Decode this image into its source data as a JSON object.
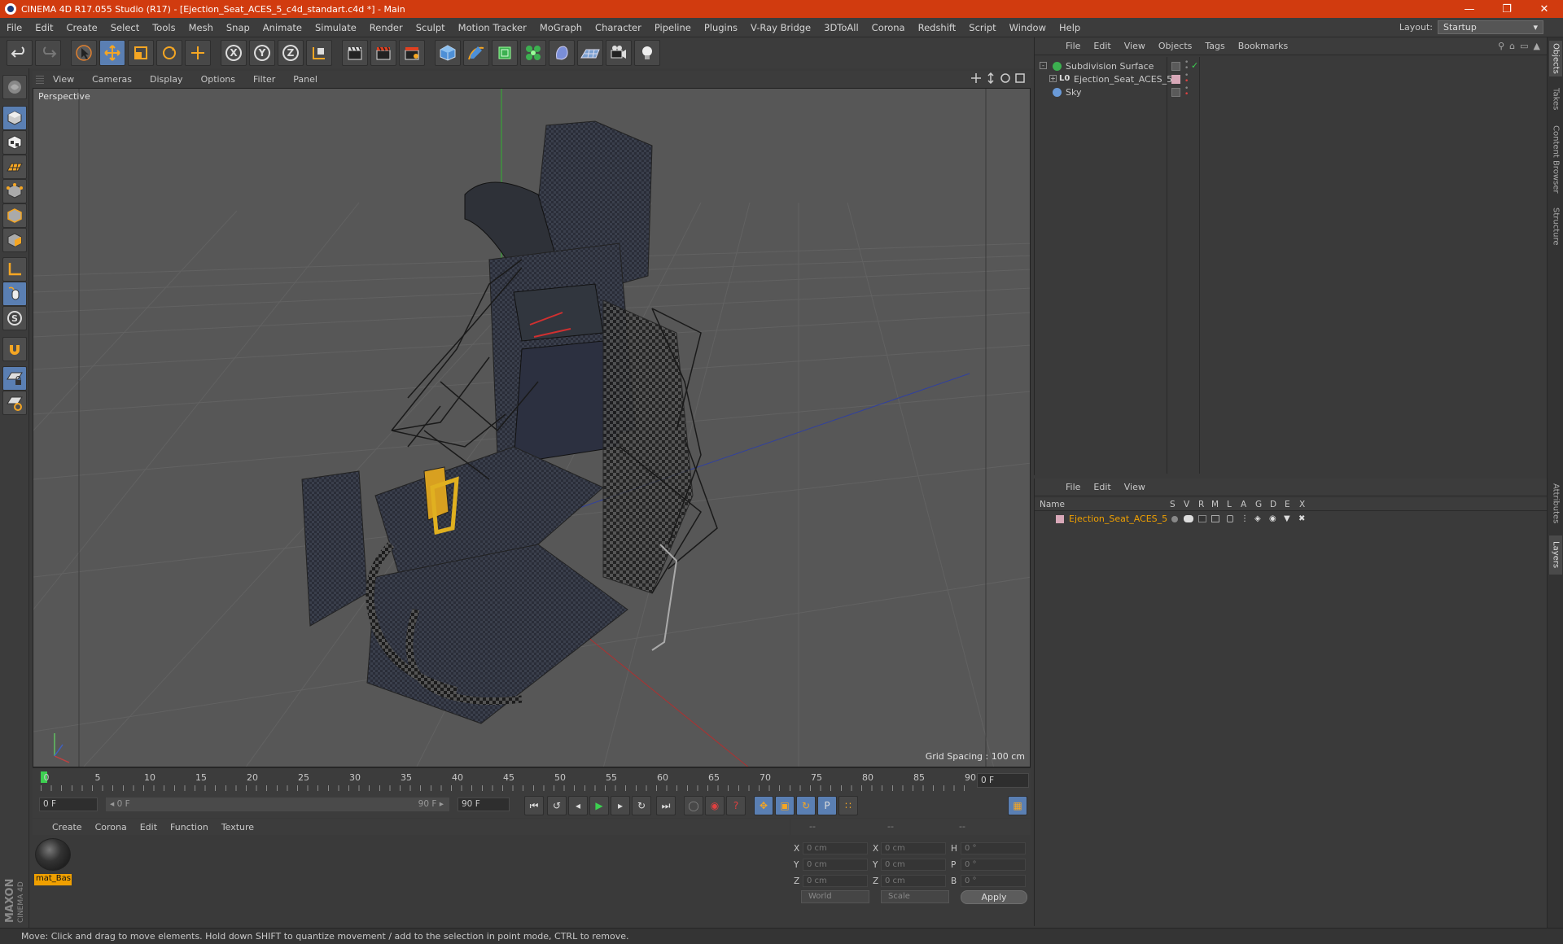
{
  "titlebar": {
    "title": "CINEMA 4D R17.055 Studio (R17) - [Ejection_Seat_ACES_5_c4d_standart.c4d *] - Main",
    "minimize": "—",
    "restore": "❐",
    "close": "✕"
  },
  "menubar": {
    "items": [
      "File",
      "Edit",
      "Create",
      "Select",
      "Tools",
      "Mesh",
      "Snap",
      "Animate",
      "Simulate",
      "Render",
      "Sculpt",
      "Motion Tracker",
      "MoGraph",
      "Character",
      "Pipeline",
      "Plugins",
      "V-Ray Bridge",
      "3DToAll",
      "Corona",
      "Redshift",
      "Script",
      "Window",
      "Help"
    ],
    "layout_label": "Layout:",
    "layout_value": "Startup"
  },
  "viewport": {
    "menu": [
      "View",
      "Cameras",
      "Display",
      "Options",
      "Filter",
      "Panel"
    ],
    "label": "Perspective",
    "grid_spacing": "Grid Spacing : 100 cm"
  },
  "timeline": {
    "ticks": [
      "0",
      "5",
      "10",
      "15",
      "20",
      "25",
      "30",
      "35",
      "40",
      "45",
      "50",
      "55",
      "60",
      "65",
      "70",
      "75",
      "80",
      "85",
      "90"
    ],
    "current_frame": "0 F"
  },
  "transport": {
    "start_field": "0 F",
    "range_start": "◂ 0 F",
    "range_end": "90 F ▸",
    "end_field": "90 F"
  },
  "material_manager": {
    "menu": [
      "Create",
      "Corona",
      "Edit",
      "Function",
      "Texture"
    ],
    "material_name": "mat_Bas"
  },
  "coordinates": {
    "header": [
      "--",
      "--",
      "--"
    ],
    "rows": [
      {
        "a": "X",
        "av": "0 cm",
        "b": "X",
        "bv": "0 cm",
        "c": "H",
        "cv": "0 °"
      },
      {
        "a": "Y",
        "av": "0 cm",
        "b": "Y",
        "bv": "0 cm",
        "c": "P",
        "cv": "0 °"
      },
      {
        "a": "Z",
        "av": "0 cm",
        "b": "Z",
        "bv": "0 cm",
        "c": "B",
        "cv": "0 °"
      }
    ],
    "world": "World",
    "scale": "Scale",
    "apply": "Apply"
  },
  "status": "Move: Click and drag to move elements. Hold down SHIFT to quantize movement / add to the selection in point mode, CTRL to remove.",
  "object_manager": {
    "menu": [
      "File",
      "Edit",
      "View",
      "Objects",
      "Tags",
      "Bookmarks"
    ],
    "objects": [
      "Subdivision Surface",
      "Ejection_Seat_ACES_5",
      "Sky"
    ]
  },
  "layer_manager": {
    "menu": [
      "File",
      "Edit",
      "View"
    ],
    "columns": [
      "Name",
      "S",
      "V",
      "R",
      "M",
      "L",
      "A",
      "G",
      "D",
      "E",
      "X"
    ],
    "layer_name": "Ejection_Seat_ACES_5"
  },
  "right_tabs": [
    "Objects",
    "Takes",
    "Content Browser",
    "Structure",
    "Attributes",
    "Layers"
  ],
  "logo": {
    "line1": "MAXON",
    "line2": "CINEMA 4D"
  },
  "colors": {
    "title_bar": "#d13b0f",
    "accent_orange": "#f0a000",
    "selection_blue": "#5a7fb3"
  }
}
